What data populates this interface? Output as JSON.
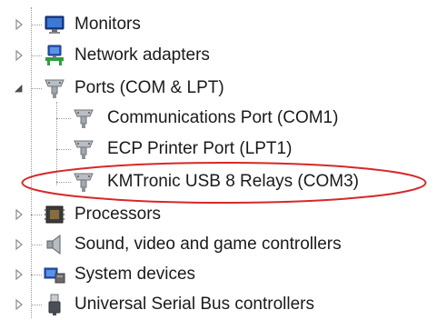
{
  "device_tree": {
    "items": [
      {
        "label": "Monitors",
        "icon": "monitor-icon",
        "expander": "collapsed"
      },
      {
        "label": "Network adapters",
        "icon": "network-adapter-icon",
        "expander": "collapsed"
      },
      {
        "label": "Ports (COM & LPT)",
        "icon": "port-connector-icon",
        "expander": "expanded"
      },
      {
        "label": "Communications Port (COM1)",
        "icon": "port-connector-icon",
        "expander": "none"
      },
      {
        "label": "ECP Printer Port (LPT1)",
        "icon": "port-connector-icon",
        "expander": "none"
      },
      {
        "label": "KMTronic USB 8 Relays (COM3)",
        "icon": "port-connector-icon",
        "expander": "none"
      },
      {
        "label": "Processors",
        "icon": "processor-icon",
        "expander": "collapsed"
      },
      {
        "label": "Sound, video and game controllers",
        "icon": "speaker-icon",
        "expander": "collapsed"
      },
      {
        "label": "System devices",
        "icon": "system-devices-icon",
        "expander": "collapsed"
      },
      {
        "label": "Universal Serial Bus controllers",
        "icon": "usb-plug-icon",
        "expander": "collapsed"
      }
    ]
  },
  "annotation": {
    "highlight_color": "#d62828",
    "highlighted_item": "KMTronic USB 8 Relays (COM3)"
  },
  "colors": {
    "tree_line": "#9a9a9a",
    "expander": "#8c8c8c",
    "text": "#1a1a1a"
  }
}
